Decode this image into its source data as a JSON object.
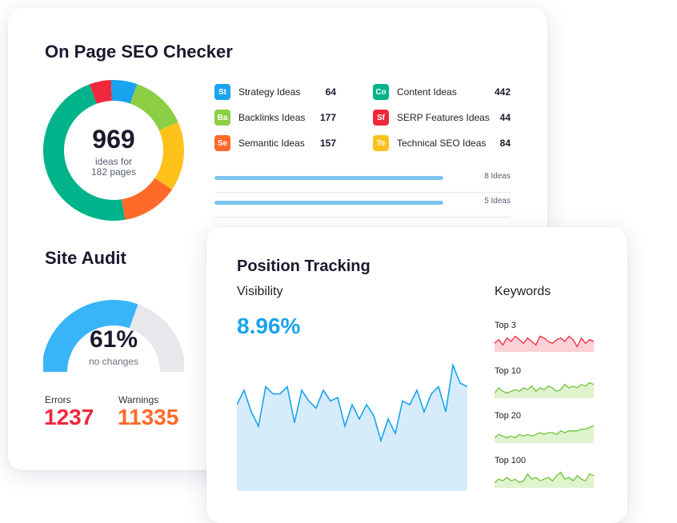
{
  "seo": {
    "title": "On Page SEO Checker",
    "total": "969",
    "total_sub": "ideas for\n182 pages",
    "donut_segments": [
      {
        "color": "#f0283c",
        "value": 5
      },
      {
        "color": "#1aa3ee",
        "value": 6
      },
      {
        "color": "#8ccf45",
        "value": 13
      },
      {
        "color": "#ffc21a",
        "value": 16
      },
      {
        "color": "#ff6a2b",
        "value": 13
      },
      {
        "color": "#00b38a",
        "value": 47
      }
    ],
    "ideas_left": [
      {
        "badge": "St",
        "color": "#1aa3ee",
        "label": "Strategy Ideas",
        "value": "64"
      },
      {
        "badge": "Ba",
        "color": "#8ccf45",
        "label": "Backlinks Ideas",
        "value": "177"
      },
      {
        "badge": "Se",
        "color": "#ff6a2b",
        "label": "Semantic Ideas",
        "value": "157"
      }
    ],
    "ideas_right": [
      {
        "badge": "Co",
        "color": "#00b38a",
        "label": "Content Ideas",
        "value": "442"
      },
      {
        "badge": "Sf",
        "color": "#f0283c",
        "label": "SERP Features Ideas",
        "value": "44"
      },
      {
        "badge": "Te",
        "color": "#ffc21a",
        "label": "Technical SEO Ideas",
        "value": "84"
      }
    ],
    "bars": [
      {
        "label": "8 Ideas"
      },
      {
        "label": "5 Ideas"
      }
    ]
  },
  "audit": {
    "title": "Site Audit",
    "percent": "61%",
    "percent_value": 0.61,
    "sub": "no changes",
    "errors_label": "Errors",
    "errors_value": "1237",
    "warnings_label": "Warnings",
    "warnings_value": "11335",
    "colors": {
      "gauge": "#3ab4f8",
      "track": "#e6e8ec",
      "errors": "#f0283c",
      "warnings": "#ff6a2b"
    }
  },
  "tracking": {
    "title": "Position Tracking",
    "visibility_label": "Visibility",
    "visibility_value": "8.96%",
    "keywords_label": "Keywords",
    "visibility_series": [
      34,
      38,
      32,
      28,
      39,
      37,
      37,
      39,
      29,
      38,
      35,
      33,
      38,
      35,
      36,
      28,
      34,
      30,
      34,
      31,
      24,
      30,
      26,
      35,
      34,
      38,
      32,
      37,
      39,
      32,
      45,
      40,
      39
    ],
    "keyword_groups": [
      {
        "label": "Top 3",
        "color": "#f0283c",
        "fill": "#fbd0d6",
        "series": [
          5,
          7,
          4,
          8,
          6,
          9,
          7,
          5,
          8,
          6,
          4,
          9,
          8,
          6,
          5,
          7,
          8,
          6,
          9,
          7,
          3,
          8,
          5,
          7,
          6
        ]
      },
      {
        "label": "Top 10",
        "color": "#6fc33b",
        "fill": "#dff3cf",
        "series": [
          3,
          6,
          4,
          3,
          4,
          5,
          4,
          6,
          5,
          7,
          4,
          6,
          5,
          7,
          6,
          4,
          5,
          8,
          6,
          7,
          6,
          8,
          7,
          9,
          8
        ]
      },
      {
        "label": "Top 20",
        "color": "#6fc33b",
        "fill": "#dff3cf",
        "series": [
          3,
          5,
          4,
          3,
          4,
          3,
          5,
          4,
          5,
          4,
          5,
          6,
          5,
          6,
          6,
          5,
          7,
          6,
          7,
          7,
          7,
          8,
          8,
          9,
          10
        ]
      },
      {
        "label": "Top 100",
        "color": "#6fc33b",
        "fill": "#dff3cf",
        "series": [
          3,
          5,
          4,
          6,
          4,
          5,
          3,
          4,
          8,
          5,
          6,
          4,
          5,
          6,
          4,
          7,
          9,
          5,
          6,
          4,
          7,
          5,
          4,
          8,
          7
        ]
      }
    ],
    "colors": {
      "accent": "#1aa3ee",
      "area": "#d6ecfb",
      "line": "#1aa3ee"
    }
  }
}
